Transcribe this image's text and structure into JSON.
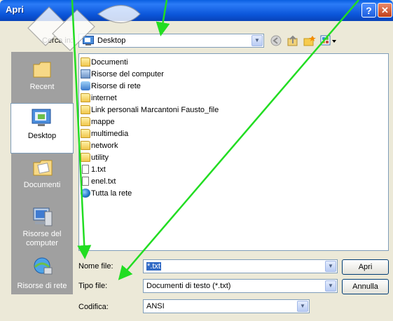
{
  "window": {
    "title": "Apri",
    "help_label": "?",
    "close_label": "✕"
  },
  "lookin": {
    "label": "Cerca in:",
    "value": "Desktop"
  },
  "toolbar": {
    "back_icon": "back-arrow-icon",
    "up_icon": "up-folder-icon",
    "newfolder_icon": "new-folder-icon",
    "views_icon": "views-menu-icon"
  },
  "places": [
    {
      "label": "Recent",
      "icon": "recent-folder-icon",
      "selected": false
    },
    {
      "label": "Desktop",
      "icon": "desktop-icon",
      "selected": true
    },
    {
      "label": "Documenti",
      "icon": "documents-icon",
      "selected": false
    },
    {
      "label": "Risorse del computer",
      "icon": "my-computer-icon",
      "selected": false
    },
    {
      "label": "Risorse di rete",
      "icon": "network-places-icon",
      "selected": false
    }
  ],
  "files": [
    {
      "name": "Documenti",
      "icon": "folder-icon"
    },
    {
      "name": "Risorse del computer",
      "icon": "computer-icon"
    },
    {
      "name": "Risorse di rete",
      "icon": "network-icon"
    },
    {
      "name": "internet",
      "icon": "folder-icon"
    },
    {
      "name": "Link personali Marcantoni Fausto_file",
      "icon": "folder-icon"
    },
    {
      "name": "mappe",
      "icon": "folder-icon"
    },
    {
      "name": "multimedia",
      "icon": "folder-icon"
    },
    {
      "name": "network",
      "icon": "folder-icon"
    },
    {
      "name": "utility",
      "icon": "folder-icon"
    },
    {
      "name": "1.txt",
      "icon": "text-file-icon"
    },
    {
      "name": "enel.txt",
      "icon": "text-file-icon"
    },
    {
      "name": "Tutta la rete",
      "icon": "globe-icon"
    }
  ],
  "filename": {
    "label": "Nome file:",
    "value": "*.txt"
  },
  "filetype": {
    "label": "Tipo file:",
    "value": "Documenti di testo (*.txt)"
  },
  "encoding": {
    "label": "Codifica:",
    "value": "ANSI"
  },
  "buttons": {
    "open": "Apri",
    "cancel": "Annulla"
  },
  "annotation_color": "#22DD22"
}
